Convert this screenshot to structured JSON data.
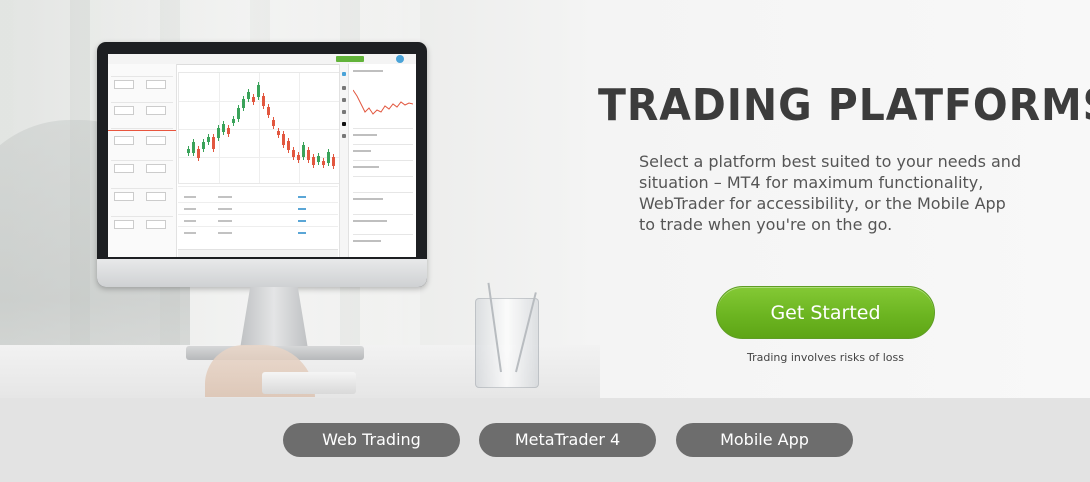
{
  "hero": {
    "title": "TRADING PLATFORMS",
    "description": "Select a platform best suited to your needs and situation – MT4 for maximum functionality, WebTrader for accessibility, or the Mobile App to trade when you're on the go.",
    "cta_label": "Get Started",
    "risk_note": "Trading involves risks of loss"
  },
  "tabs": [
    {
      "label": "Web Trading"
    },
    {
      "label": "MetaTrader 4"
    },
    {
      "label": "Mobile App"
    }
  ],
  "colors": {
    "accent_green": "#6cb521",
    "tab_gray": "#6d6d6d",
    "title_text": "#3c3c3c"
  },
  "icons": [
    "monitor-illustration",
    "pencil-cup-illustration"
  ]
}
